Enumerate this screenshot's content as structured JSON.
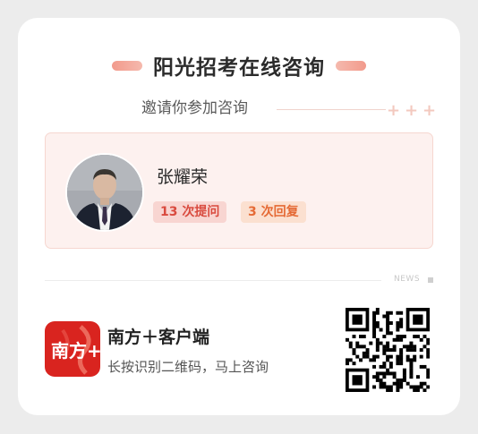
{
  "title": "阳光招考在线咨询",
  "invite": "邀请你参加咨询",
  "invite_decor": "+ + +",
  "expert": {
    "name": "张耀荣",
    "questions_label": "13 次提问",
    "replies_label": "3 次回复"
  },
  "news_label": "NEWS",
  "app": {
    "icon_text": "南方+",
    "name": "南方＋客户端",
    "subtitle": "长按识别二维码，马上咨询"
  },
  "colors": {
    "accent_red": "#d9241f",
    "tag_question": "#d94a3e",
    "tag_reply": "#e56a35",
    "card_bg": "#fdf1ef"
  },
  "icons": [
    "title-pill-decoration",
    "avatar-photo",
    "nanfang-app-icon",
    "qr-code"
  ]
}
